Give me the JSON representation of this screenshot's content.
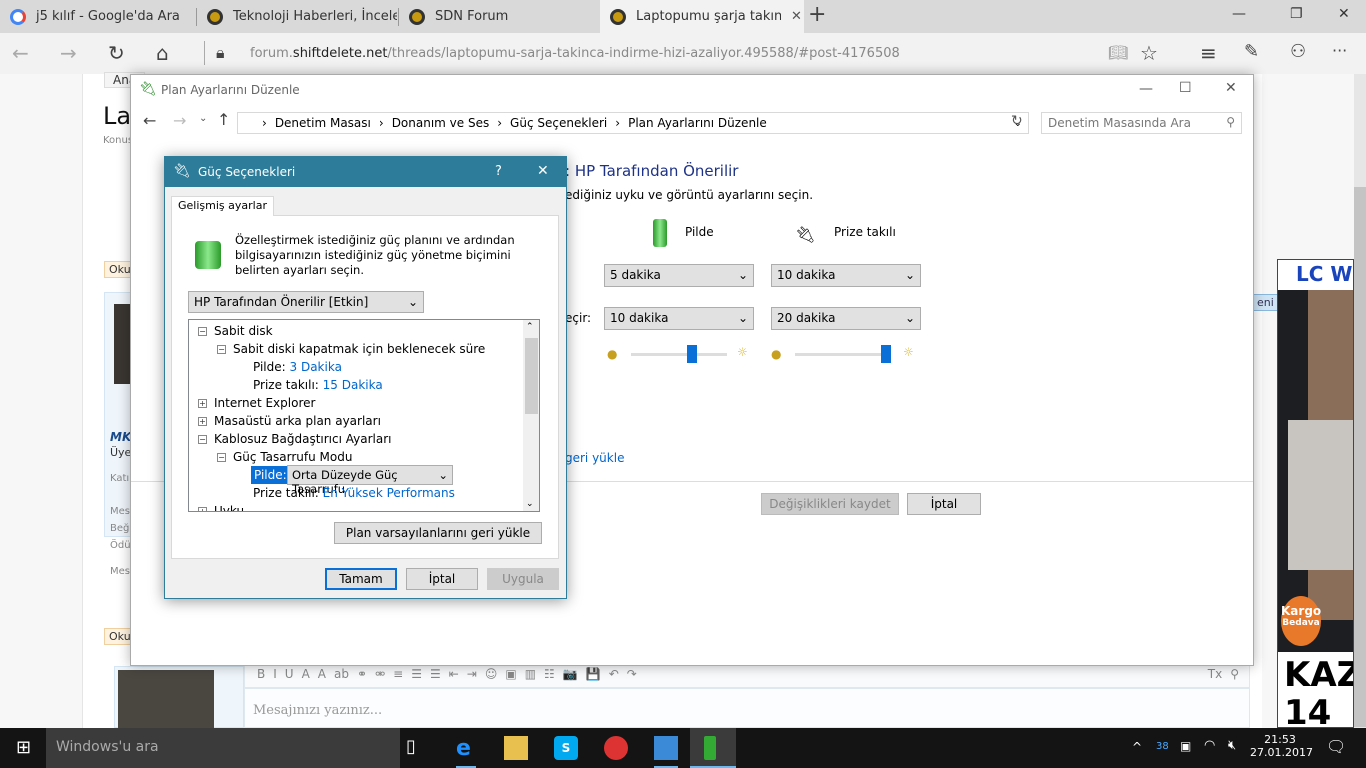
{
  "browser": {
    "tabs": [
      {
        "label": "j5 kılıf - Google'da Ara",
        "icon": "google-icon"
      },
      {
        "label": "Teknoloji Haberleri, İncelem",
        "icon": "sdn-icon"
      },
      {
        "label": "SDN Forum",
        "icon": "sdn-icon"
      },
      {
        "label": "Laptopumu şarja takınca",
        "icon": "sdn-icon",
        "active": true
      }
    ],
    "close_tab": "✕",
    "new_tab": "+",
    "url_prefix": "forum.",
    "url_domain": "shiftdelete.net",
    "url_path": "/threads/laptopumu-sarja-takinca-indirme-hizi-azaliyor.495588/#post-4176508",
    "window_controls": [
      "—",
      "❐",
      "✕"
    ]
  },
  "forum": {
    "title_fragment": "Lap",
    "subtitle_fragment": "Konus",
    "tab_fragment": "Ana",
    "badge1": "Okun",
    "badge2": "Okun",
    "user_name": "MKT",
    "user_role": "Üyec",
    "stats": [
      "Katıl",
      "Mesa",
      "Beğe",
      "Ödül",
      "Mesa"
    ],
    "new_badge": "eni",
    "editor_placeholder": "Mesajınızı yazınız...",
    "editor_tools": [
      "B",
      "I",
      "U",
      "A",
      "A",
      "ab",
      "⚭",
      "⚮",
      "≡",
      "☰",
      "☰",
      "⇤",
      "⇥",
      "☺",
      "▣",
      "▥",
      "☷",
      "📷",
      "💾",
      "↶",
      "↷",
      "Tx",
      "⚲"
    ],
    "ad_brand": "LC W",
    "ad_badge_1": "Kargo",
    "ad_badge_2": "Bedava",
    "ad_text": "KAZ",
    "ad_text2": "14"
  },
  "control_panel": {
    "title": "Plan Ayarlarını Düzenle",
    "breadcrumb": [
      "Denetim Masası",
      "Donanım ve Ses",
      "Güç Seçenekleri",
      "Plan Ayarlarını Düzenle"
    ],
    "search_placeholder": "Denetim Masasında Ara",
    "heading_fragment": ": HP Tarafından Önerilir",
    "desc_fragment": "ediğiniz uyku ve görüntü ayarlarını seçin.",
    "col_battery": "Pilde",
    "col_plugged": "Prize takılı",
    "row2_label_fragment": "eçir:",
    "display_off": {
      "battery": "5 dakika",
      "plugged": "10 dakika"
    },
    "sleep": {
      "battery": "10 dakika",
      "plugged": "20 dakika"
    },
    "brightness": {
      "battery_percent": 65,
      "plugged_percent": 100
    },
    "restore_link_fragment": "geri yükle",
    "save_button": "Değişiklikleri kaydet",
    "cancel_button": "İptal"
  },
  "dialog": {
    "title": "Güç Seçenekleri",
    "help": "?",
    "close": "✕",
    "tab": "Gelişmiş ayarlar",
    "intro": "Özelleştirmek istediğiniz güç planını ve ardından bilgisayarınızın istediğiniz güç yönetme biçimini belirten ayarları seçin.",
    "plan_select": "HP Tarafından Önerilir [Etkin]",
    "tree": {
      "hdd": "Sabit disk",
      "hdd_sub": "Sabit diski kapatmak için beklenecek süre",
      "battery_label": "Pilde:",
      "hdd_battery": "3 Dakika",
      "plugged_label": "Prize takılı:",
      "hdd_plugged": "15 Dakika",
      "ie": "Internet Explorer",
      "desktop": "Masaüstü arka plan ayarları",
      "wireless": "Kablosuz Bağdaştırıcı Ayarları",
      "psm": "Güç Tasarrufu Modu",
      "psm_battery": "Orta Düzeyde Güç Tasarrufu",
      "psm_plugged": "En Yüksek Performans",
      "sleep": "Uyku"
    },
    "restore_button": "Plan varsayılanlarını geri yükle",
    "ok": "Tamam",
    "cancel": "İptal",
    "apply": "Uygula"
  },
  "taskbar": {
    "search": "Windows'u ara",
    "tray_count": "38",
    "time": "21:53",
    "date": "27.01.2017"
  }
}
